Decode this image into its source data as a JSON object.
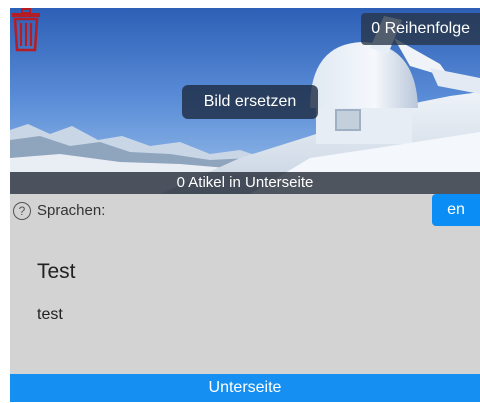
{
  "card": {
    "order_label": "0 Reihenfolge",
    "replace_image_label": "Bild ersetzen",
    "subpage_count_label": "0 Atikel in Unterseite",
    "languages_label": "Sprachen:",
    "help_symbol": "?",
    "language_button": "en",
    "title": "Test",
    "subtitle": "test",
    "bottom_button": "Unterseite"
  },
  "icons": {
    "delete": "trash-icon",
    "help": "help-circle-icon"
  },
  "colors": {
    "accent_blue": "#1590f2",
    "trash_red": "#b51c24",
    "card_background": "#d3d3d3"
  }
}
